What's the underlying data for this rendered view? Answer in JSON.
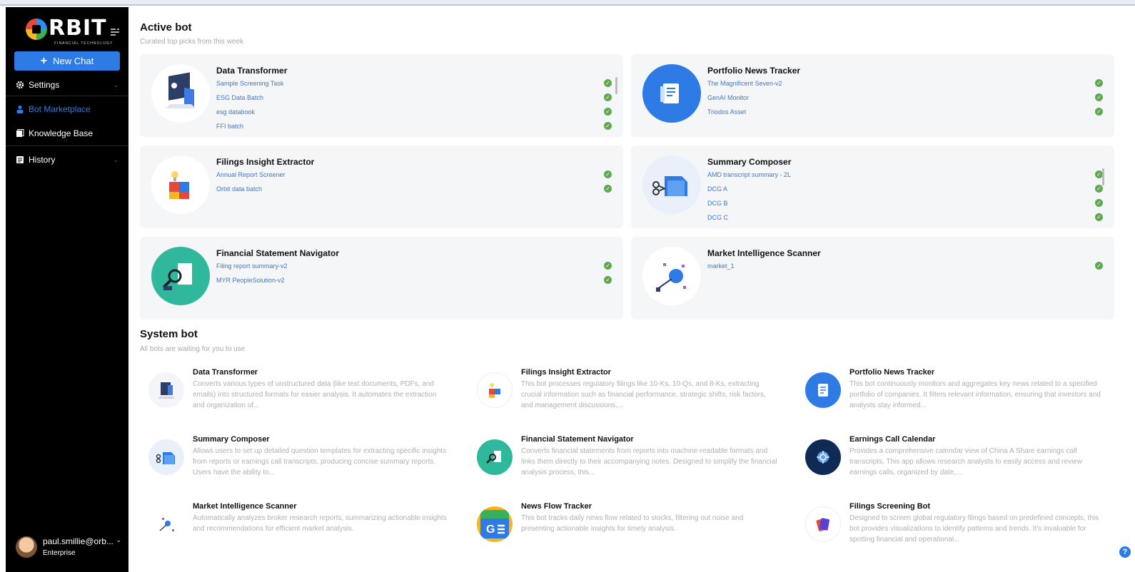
{
  "sidebar": {
    "logo_text": "RBIT",
    "logo_sub": "FINANCIAL TECHNOLOGY",
    "new_chat_label": "New Chat",
    "items": [
      {
        "label": "Settings",
        "icon": "gear-icon"
      },
      {
        "label": "Bot Marketplace",
        "icon": "bot-icon"
      },
      {
        "label": "Knowledge Base",
        "icon": "book-icon"
      },
      {
        "label": "History",
        "icon": "history-icon"
      }
    ],
    "user": {
      "name": "paul.smillie@orb...",
      "plan": "Enterprise"
    }
  },
  "active": {
    "title": "Active bot",
    "subtitle": "Curated top picks from this week",
    "cards": [
      {
        "name": "Data Transformer",
        "items": [
          "Sample Screening Task",
          "ESG Data Batch",
          "esg databook",
          "FFI batch"
        ]
      },
      {
        "name": "Portfolio News Tracker",
        "items": [
          "The Magnificent Seven-v2",
          "GenAI Monitor",
          "Triodos Asset"
        ]
      },
      {
        "name": "Filings Insight Extractor",
        "items": [
          "Annual Report Screener",
          "Orbit data batch"
        ]
      },
      {
        "name": "Summary Composer",
        "items": [
          "AMD transcript summary - 2L",
          "DCG A",
          "DCG B",
          "DCG C"
        ]
      },
      {
        "name": "Financial Statement Navigator",
        "items": [
          "Filing report summary-v2",
          "MYR PeopleSolution-v2"
        ]
      },
      {
        "name": "Market Intelligence Scanner",
        "items": [
          "market_1"
        ]
      }
    ]
  },
  "system": {
    "title": "System bot",
    "subtitle": "All bots are waiting for you to use",
    "bots": [
      {
        "name": "Data Transformer",
        "desc": "Converts various types of unstructured data (like text documents, PDFs, and emails) into structured formats for easier analysis. It automates the extraction and organization of..."
      },
      {
        "name": "Filings Insight Extractor",
        "desc": "This bot processes regulatory filings like 10-Ks, 10-Qs, and 8-Ks, extracting crucial information such as financial performance, strategic shifts, risk factors, and management discussions,..."
      },
      {
        "name": "Portfolio News Tracker",
        "desc": "This bot continuously monitors and aggregates key news related to a specified portfolio of companies. It filters relevant information, ensuring that investors and analysts stay informed..."
      },
      {
        "name": "Summary Composer",
        "desc": "Allows users to set up detailed question templates for extracting specific insights from reports or earnings call transcripts, producing concise summary reports. Users have the ability to..."
      },
      {
        "name": "Financial Statement Navigator",
        "desc": "Converts financial statements from reports into machine-readable formats and links them directly to their accompanying notes. Designed to simplify the financial analysis process, this..."
      },
      {
        "name": "Earnings Call Calendar",
        "desc": "Provides a comprehensive calendar view of China A Share earnings call transcripts. This app allows research analysts to easily access and review earnings calls, organized by date,..."
      },
      {
        "name": "Market Intelligence Scanner",
        "desc": "Automatically analyzes broker research reports, summarizing actionable insights and recommendations for efficient market analysis."
      },
      {
        "name": "News Flow Tracker",
        "desc": "This bot tracks daily news flow related to stocks, filtering out noise and presenting actionable insights for timely analysis."
      },
      {
        "name": "Filings Screening Bot",
        "desc": "Designed to screen global regulatory filings based on predefined concepts, this bot provides visualizations to identify patterns and trends. It's invaluable for spotting financial and operational..."
      }
    ]
  },
  "help_label": "?"
}
